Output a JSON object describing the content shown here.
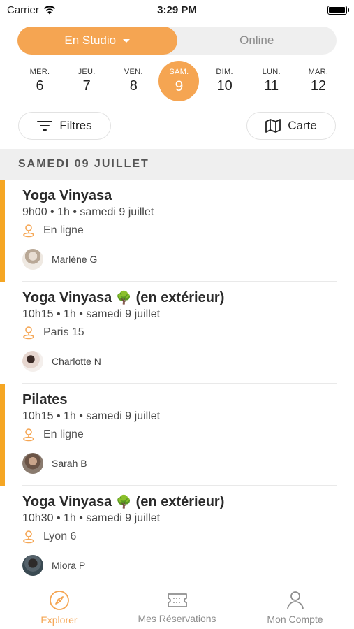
{
  "status_bar": {
    "carrier": "Carrier",
    "time": "3:29 PM"
  },
  "segmented": {
    "studio_label": "En Studio",
    "online_label": "Online"
  },
  "days": [
    {
      "name": "MER.",
      "num": "6"
    },
    {
      "name": "JEU.",
      "num": "7"
    },
    {
      "name": "VEN.",
      "num": "8"
    },
    {
      "name": "SAM.",
      "num": "9",
      "selected": true
    },
    {
      "name": "DIM.",
      "num": "10"
    },
    {
      "name": "LUN.",
      "num": "11"
    },
    {
      "name": "MAR.",
      "num": "12"
    }
  ],
  "filters": {
    "filters_label": "Filtres",
    "map_label": "Carte"
  },
  "section": {
    "title": "SAMEDI 09 JUILLET"
  },
  "classes": [
    {
      "title": "Yoga Vinyasa",
      "emoji": "",
      "suffix": "",
      "time": "9h00 • 1h • samedi 9 juillet",
      "location": "En ligne",
      "teacher": "Marlène G",
      "marked": true
    },
    {
      "title": "Yoga Vinyasa",
      "emoji": "🌳",
      "suffix": "(en extérieur)",
      "time": "10h15 • 1h • samedi 9 juillet",
      "location": "Paris 15",
      "teacher": "Charlotte N",
      "marked": false
    },
    {
      "title": "Pilates",
      "emoji": "",
      "suffix": "",
      "time": "10h15 • 1h • samedi 9 juillet",
      "location": "En ligne",
      "teacher": "Sarah B",
      "marked": true
    },
    {
      "title": "Yoga Vinyasa",
      "emoji": "🌳",
      "suffix": "(en extérieur)",
      "time": "10h30 • 1h • samedi 9 juillet",
      "location": "Lyon 6",
      "teacher": "Miora P",
      "marked": false
    }
  ],
  "tabs": {
    "explore": "Explorer",
    "reservations": "Mes Réservations",
    "account": "Mon Compte"
  },
  "colors": {
    "accent": "#f5a552",
    "marker": "#f5a623"
  }
}
